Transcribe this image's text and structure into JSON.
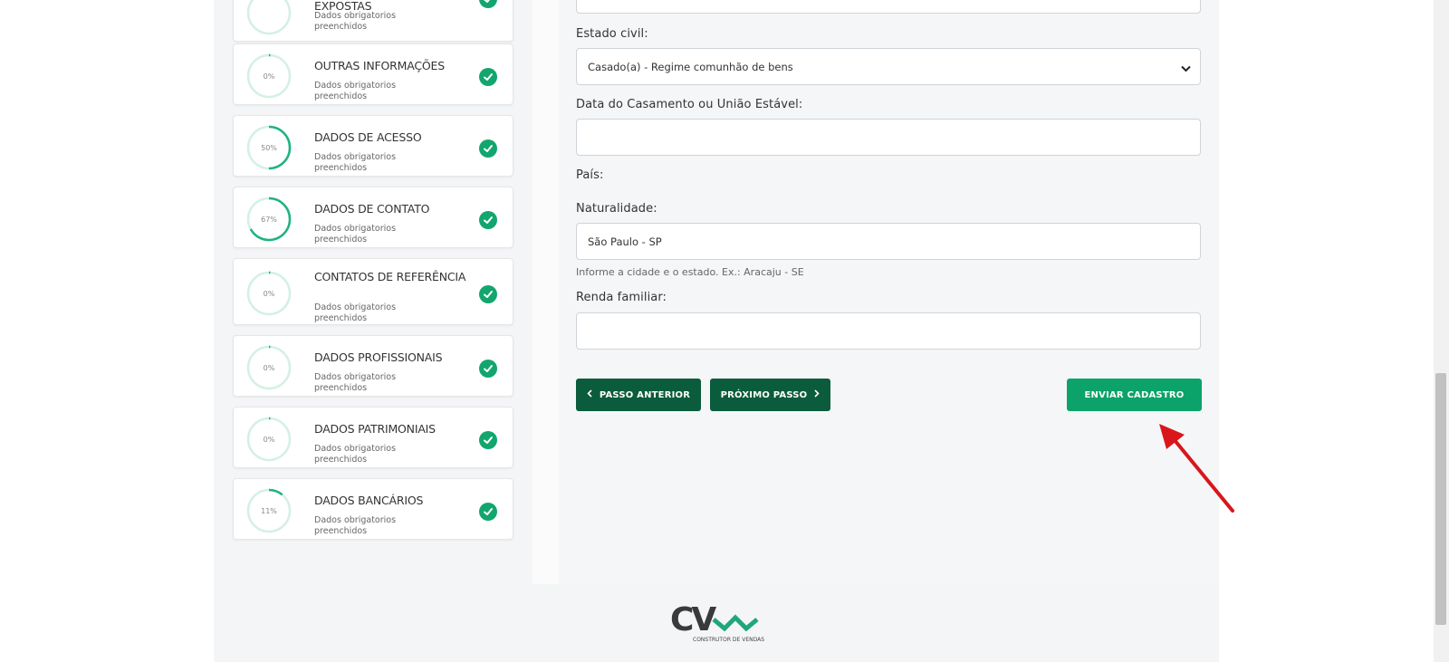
{
  "sidebar": {
    "partial_card": {
      "title": "EXPOSTAS",
      "sub1": "Dados obrigatorios",
      "sub2": "preenchidos"
    },
    "cards": [
      {
        "title": "OUTRAS INFORMAÇÕES",
        "pct": "0%",
        "progress": 0,
        "sub1": "Dados obrigatorios",
        "sub2": "preenchidos"
      },
      {
        "title": "DADOS DE ACESSO",
        "pct": "50%",
        "progress": 50,
        "sub1": "Dados obrigatorios",
        "sub2": "preenchidos"
      },
      {
        "title": "DADOS DE CONTATO",
        "pct": "67%",
        "progress": 67,
        "sub1": "Dados obrigatorios",
        "sub2": "preenchidos"
      },
      {
        "title": "CONTATOS DE REFERÊNCIA",
        "pct": "0%",
        "progress": 0,
        "sub1": "Dados obrigatorios",
        "sub2": "preenchidos"
      },
      {
        "title": "DADOS PROFISSIONAIS",
        "pct": "0%",
        "progress": 0,
        "sub1": "Dados obrigatorios",
        "sub2": "preenchidos"
      },
      {
        "title": "DADOS PATRIMONIAIS",
        "pct": "0%",
        "progress": 0,
        "sub1": "Dados obrigatorios",
        "sub2": "preenchidos"
      },
      {
        "title": "DADOS BANCÁRIOS",
        "pct": "11%",
        "progress": 11,
        "sub1": "Dados obrigatorios",
        "sub2": "preenchidos"
      }
    ]
  },
  "form": {
    "estado_civil_label": "Estado civil:",
    "estado_civil_value": "Casado(a) - Regime comunhão de bens",
    "data_casamento_label": "Data do Casamento ou União Estável:",
    "data_casamento_value": "",
    "pais_label": "País:",
    "naturalidade_label": "Naturalidade:",
    "naturalidade_value": "São Paulo - SP",
    "naturalidade_help": "Informe a cidade e o estado. Ex.: Aracaju - SE",
    "renda_label": "Renda familiar:",
    "renda_value": ""
  },
  "buttons": {
    "prev": "PASSO ANTERIOR",
    "next": "PRÓXIMO PASSO",
    "submit": "ENVIAR CADASTRO"
  },
  "footer": {
    "logo_text": "CV",
    "logo_tagline": "CONSTRUTOR DE VENDAS"
  },
  "colors": {
    "accent": "#12a66e",
    "dark_button": "#0a5c3d",
    "submit_button": "#0ba36a",
    "annotation_arrow": "#d9161c"
  }
}
